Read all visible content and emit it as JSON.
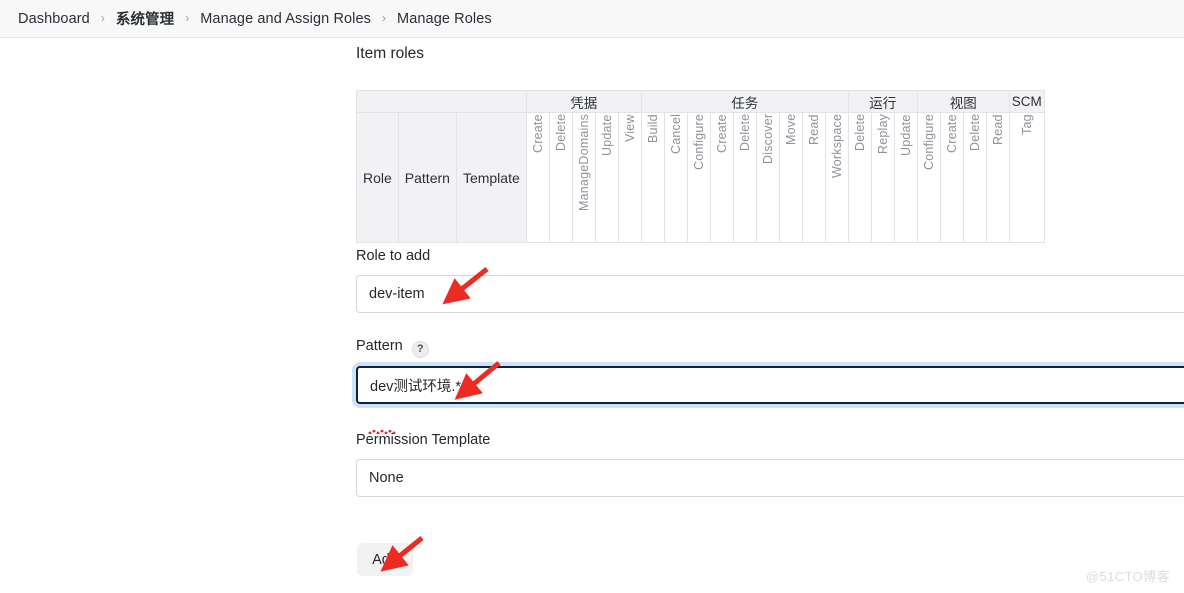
{
  "breadcrumb": {
    "separator": "›",
    "items": [
      {
        "label": "Dashboard",
        "bold": false
      },
      {
        "label": "系统管理",
        "bold": true
      },
      {
        "label": "Manage and Assign Roles",
        "bold": false
      },
      {
        "label": "Manage Roles",
        "bold": false
      }
    ]
  },
  "main": {
    "section_title": "Item roles"
  },
  "matrix": {
    "fixed_columns": [
      "Role",
      "Pattern",
      "Template"
    ],
    "groups": [
      {
        "label": "",
        "span": 3,
        "fixed": true
      },
      {
        "label": "凭据",
        "span": 5,
        "fixed": false
      },
      {
        "label": "任务",
        "span": 9,
        "fixed": false
      },
      {
        "label": "运行",
        "span": 3,
        "fixed": false
      },
      {
        "label": "视图",
        "span": 4,
        "fixed": false
      },
      {
        "label": "SCM",
        "span": 1,
        "fixed": false
      }
    ],
    "permission_columns": [
      "Create",
      "Delete",
      "ManageDomains",
      "Update",
      "View",
      "Build",
      "Cancel",
      "Configure",
      "Create",
      "Delete",
      "Discover",
      "Move",
      "Read",
      "Workspace",
      "Delete",
      "Replay",
      "Update",
      "Configure",
      "Create",
      "Delete",
      "Read",
      "Tag"
    ],
    "rows": []
  },
  "form": {
    "role_to_add": {
      "label": "Role to add",
      "value": "dev-item",
      "placeholder": ""
    },
    "pattern": {
      "label": "Pattern",
      "help_icon": "question-mark-icon",
      "help_glyph": "?",
      "value": "dev测试环境.*",
      "placeholder": "",
      "focused": true,
      "spellcheck_error_word": "dev"
    },
    "permission_template": {
      "label": "Permission Template",
      "value": "None",
      "placeholder": ""
    },
    "add_button": {
      "label": "Add"
    }
  },
  "annotations": {
    "arrow_color": "#ee2b22",
    "arrows": [
      {
        "name": "arrow-to-role-to-add"
      },
      {
        "name": "arrow-to-pattern"
      },
      {
        "name": "arrow-to-add-button"
      }
    ]
  },
  "watermark": {
    "text": "@51CTO博客"
  },
  "colors": {
    "accent_focus": "#0b2340",
    "focus_ring": "#cfe1f5",
    "border": "#cfd8dd",
    "header_bg": "#f2f2f5",
    "bar_bg": "#f8f8f9"
  }
}
